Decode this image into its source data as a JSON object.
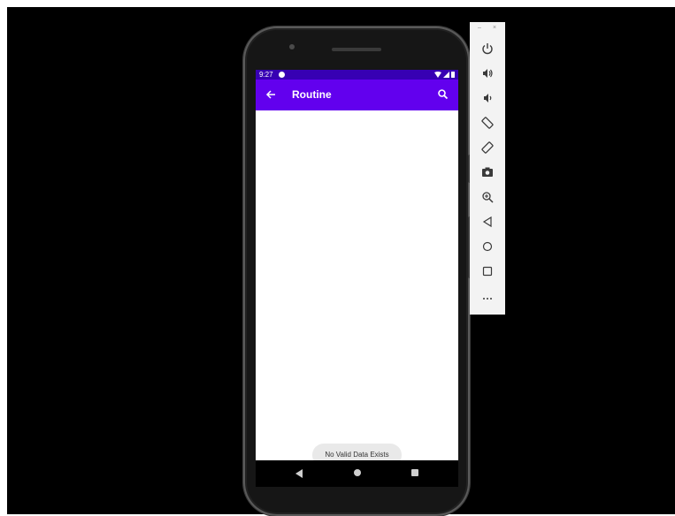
{
  "status_bar": {
    "time": "9:27"
  },
  "app_bar": {
    "title": "Routine"
  },
  "toast": {
    "message": "No Valid Data Exists"
  },
  "toolbar": {
    "minimize": "–",
    "close": "×",
    "items": [
      {
        "icon": "power-icon"
      },
      {
        "icon": "volume-up-icon"
      },
      {
        "icon": "volume-down-icon"
      },
      {
        "icon": "rotate-left-icon"
      },
      {
        "icon": "rotate-right-icon"
      },
      {
        "icon": "camera-icon"
      },
      {
        "icon": "zoom-icon"
      },
      {
        "icon": "back-icon"
      },
      {
        "icon": "home-icon"
      },
      {
        "icon": "overview-icon"
      },
      {
        "icon": "more-icon"
      }
    ]
  },
  "colors": {
    "status_bar": "#3700b3",
    "app_bar": "#6200ee",
    "toast_bg": "#e9e9e9",
    "toolbar_bg": "#f3f3f3"
  }
}
